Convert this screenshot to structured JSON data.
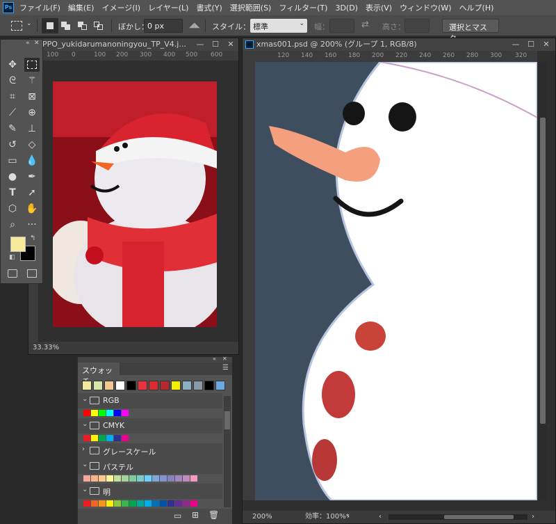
{
  "menu": {
    "logo": "Ps",
    "items": [
      "ファイル(F)",
      "編集(E)",
      "イメージ(I)",
      "レイヤー(L)",
      "書式(Y)",
      "選択範囲(S)",
      "フィルター(T)",
      "3D(D)",
      "表示(V)",
      "ウィンドウ(W)",
      "ヘルプ(H)"
    ]
  },
  "options": {
    "feather_label": "ぼかし：",
    "feather_value": "0 px",
    "style_label": "スタイル：",
    "style_value": "標準",
    "width_label": "幅：",
    "height_label": "高さ：",
    "select_mask_label": "選択とマスク..."
  },
  "doc1": {
    "title": "PPO_yukidarumanoningyou_TP_V4.j...",
    "zoom": "33.33%",
    "ruler_top": [
      "100",
      "0",
      "100",
      "200",
      "300",
      "400",
      "500",
      "600",
      "700"
    ]
  },
  "doc2": {
    "title": "xmas001.psd @ 200% (グループ 1, RGB/8)",
    "zoom": "200%",
    "efficiency": "効率：100%*",
    "ruler_top": [
      "120",
      "140",
      "160",
      "180",
      "200",
      "220",
      "240",
      "260",
      "280",
      "300",
      "320"
    ]
  },
  "swatches": {
    "tab_label": "スウォッチ",
    "recent": [
      "#f3e8a0",
      "#d6e6a8",
      "#f1c88f",
      "#ffffff",
      "#000000",
      "#e8323e",
      "#d92a32",
      "#b22a2e",
      "#f5f000",
      "#8cb0c2",
      "#8a9aa8",
      "#000000",
      "#6aa8e0"
    ],
    "groups": [
      {
        "label": "RGB",
        "colors": [
          "#ff0000",
          "#ffff00",
          "#00ff00",
          "#00ffff",
          "#0000ff",
          "#ff00ff"
        ]
      },
      {
        "label": "CMYK",
        "colors": [
          "#ed1c24",
          "#fff200",
          "#00a651",
          "#00aeef",
          "#2e3192",
          "#ec008c"
        ]
      },
      {
        "label": "グレースケール",
        "colors": []
      },
      {
        "label": "パステル",
        "colors": [
          "#f5a89a",
          "#f7b48a",
          "#fbc98e",
          "#fff59b",
          "#c4df9b",
          "#a3d39c",
          "#82ca9c",
          "#7accc8",
          "#6dcff6",
          "#7da7d9",
          "#8393ca",
          "#8781bd",
          "#a187be",
          "#bd8cbf",
          "#f49ac1"
        ]
      },
      {
        "label": "明",
        "colors": [
          "#ed1c24",
          "#f26522",
          "#f7941d",
          "#fff200",
          "#8dc63f",
          "#39b54a",
          "#00a651",
          "#00a99d",
          "#00aeef",
          "#0072bc",
          "#0054a6",
          "#2e3192",
          "#662d91",
          "#92278f",
          "#ec008c"
        ]
      }
    ]
  },
  "colors": {
    "foreground": "#f7e99a",
    "background": "#000000",
    "canvas_bg": "#3e4e5e"
  }
}
